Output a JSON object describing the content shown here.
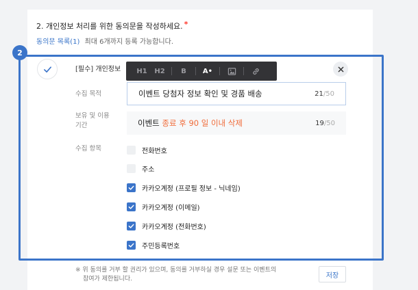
{
  "question": {
    "title": "2. 개인정보 처리를 위한 동의문을 작성하세요.",
    "required_mark": "*",
    "list_link": "동의문 목록(1)",
    "hint": "최대 6개까지 등록 가능합니다."
  },
  "step_badge": "2",
  "item": {
    "title": "[필수] 개인정보"
  },
  "toolbar": {
    "buttons": [
      "H1",
      "H2",
      "B",
      "A•"
    ],
    "image_icon": "image-icon",
    "link_icon": "link-icon"
  },
  "fields": {
    "purpose": {
      "label": "수집 목적",
      "value": "이벤트 당첨자 정보 확인 및 경품 배송",
      "count": "21",
      "max": "/50"
    },
    "retention": {
      "label_line1": "보유 및 이용",
      "label_line2": "기간",
      "value_prefix": "이벤트 ",
      "value_accent": "종료 후 90 일 이내 삭제",
      "count": "19",
      "max": "/50"
    },
    "items": {
      "label": "수집 항목",
      "options": [
        {
          "label": "전화번호",
          "checked": false
        },
        {
          "label": "주소",
          "checked": false
        },
        {
          "label": "카카오계정 (프로필 정보 - 닉네임)",
          "checked": true
        },
        {
          "label": "카카오계정 (이메일)",
          "checked": true
        },
        {
          "label": "카카오계정 (전화번호)",
          "checked": true
        },
        {
          "label": "주민등록번호",
          "checked": true
        }
      ]
    }
  },
  "footer": {
    "note_line1": "※ 위 동의를 거부 할 권리가 있으며, 동의를 거부하실 경우 설문 또는 이벤트의",
    "note_line2": "참여가 제한됩니다.",
    "save_label": "저장"
  },
  "colors": {
    "accent": "#3b74c9",
    "highlight": "#f06c3a",
    "required": "#ff3b30"
  }
}
